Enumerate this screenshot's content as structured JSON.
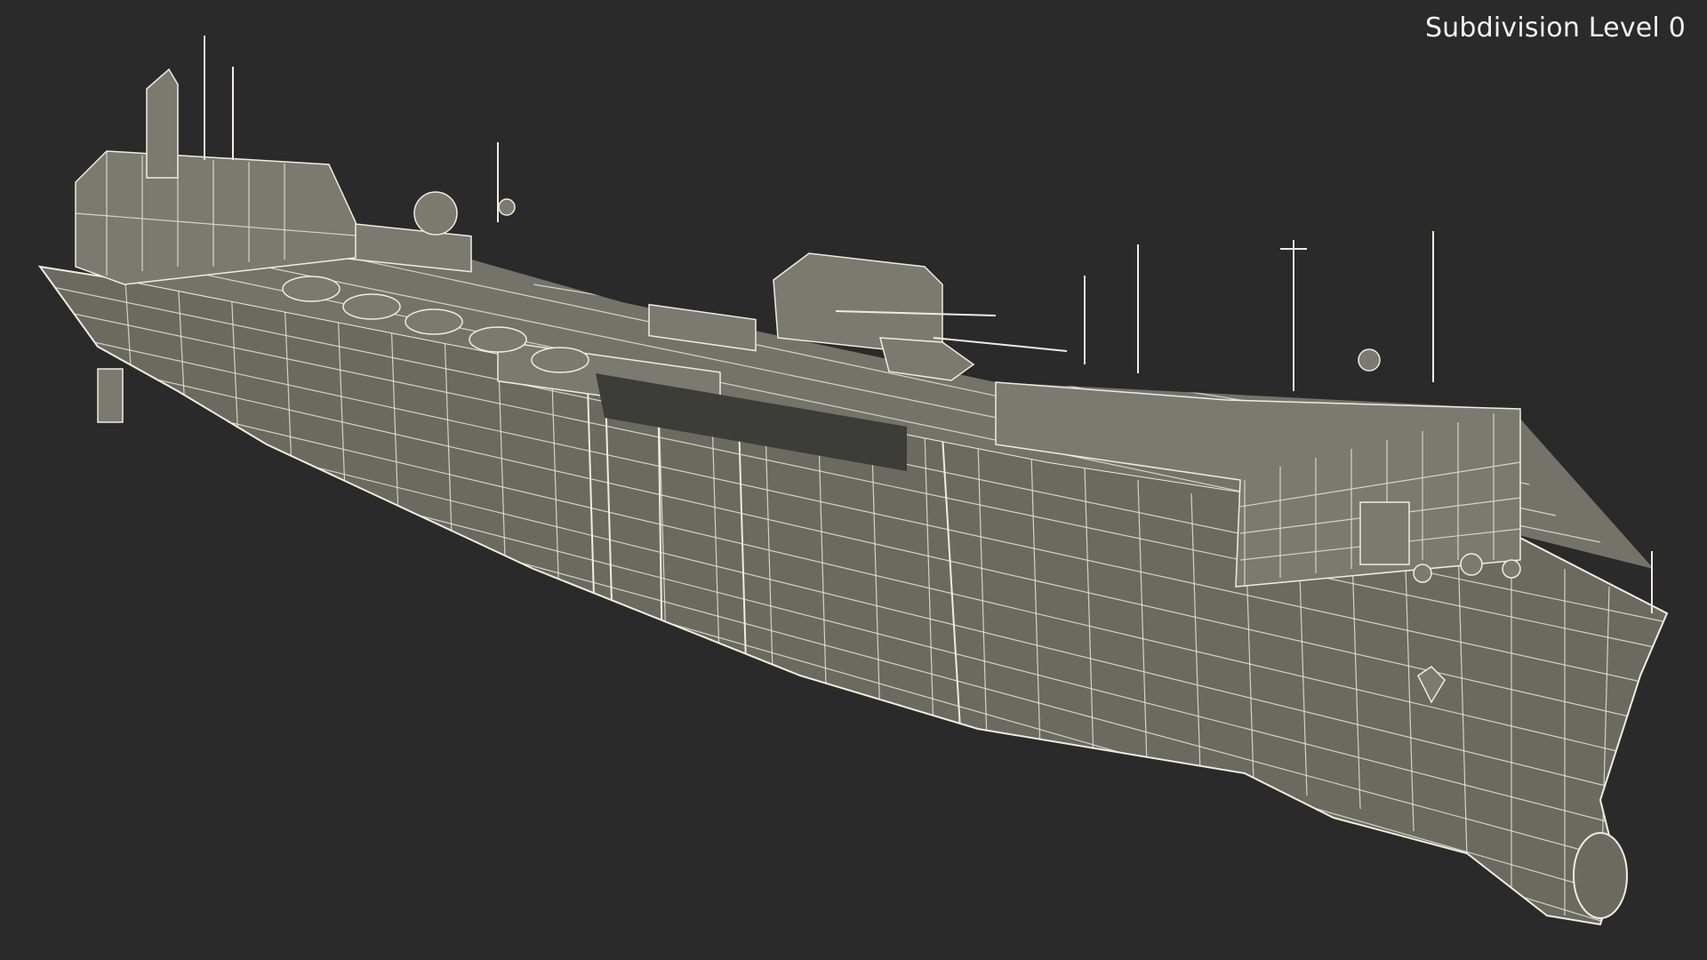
{
  "viewport": {
    "background": "#2a2a2a",
    "overlay_label": "Subdivision Level 0"
  },
  "model": {
    "wire_color": "#e8e4d6",
    "surface_color": "#6a6a60"
  }
}
